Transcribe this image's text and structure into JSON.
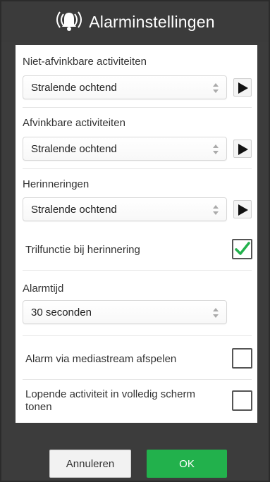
{
  "header": {
    "title": "Alarminstellingen",
    "icon": "alarm-bell-icon"
  },
  "sections": {
    "non_checkable": {
      "label": "Niet-afvinkbare activiteiten",
      "value": "Stralende ochtend"
    },
    "checkable": {
      "label": "Afvinkbare activiteiten",
      "value": "Stralende ochtend"
    },
    "reminders": {
      "label": "Herinneringen",
      "value": "Stralende ochtend"
    },
    "vibrate": {
      "label": "Trilfunctie bij herinnering",
      "checked": true
    },
    "alarm_time": {
      "label": "Alarmtijd",
      "value": "30 seconden"
    },
    "media_stream": {
      "label": "Alarm via mediastream afspelen",
      "checked": false
    },
    "fullscreen": {
      "label": "Lopende activiteit in volledig scherm tonen",
      "checked": false
    }
  },
  "footer": {
    "cancel_label": "Annuleren",
    "ok_label": "OK"
  },
  "colors": {
    "header_bg": "#3b3b3b",
    "check_green": "#22b14c",
    "ok_bg": "#22b14c"
  }
}
